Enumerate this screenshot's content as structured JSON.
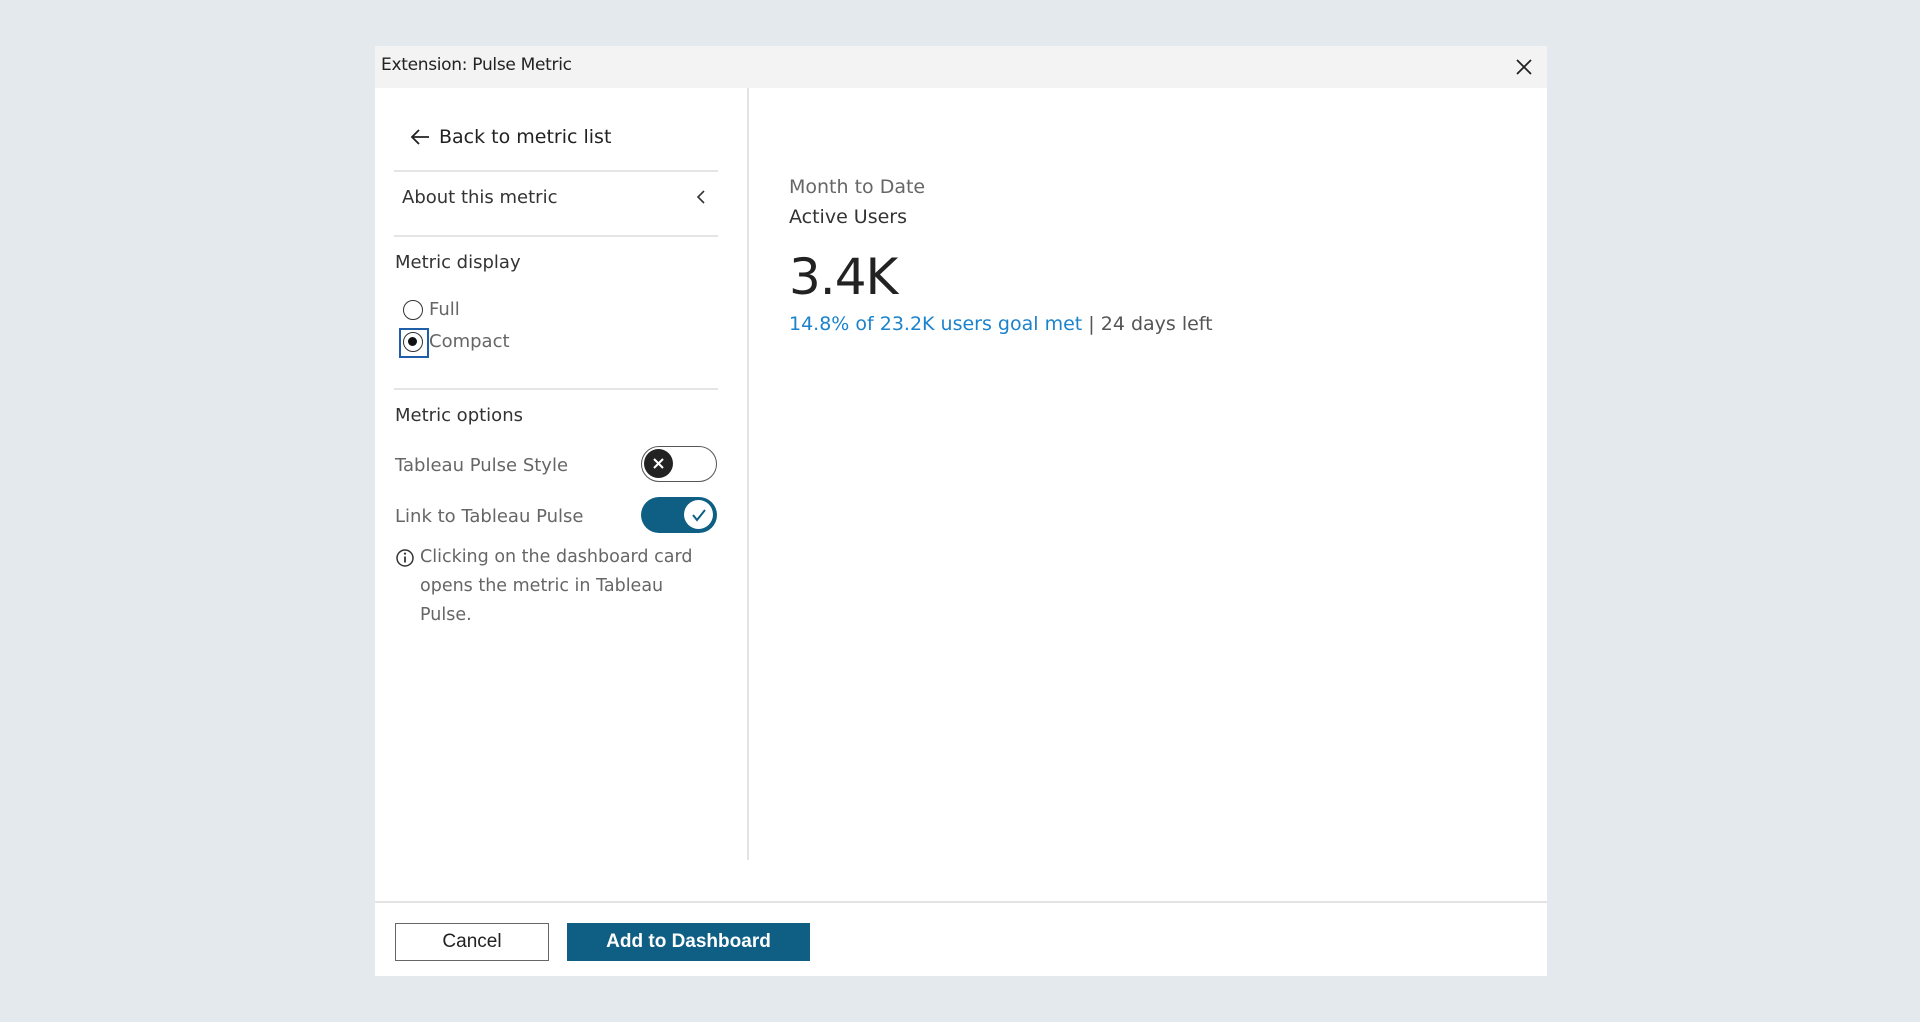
{
  "dialog": {
    "title": "Extension: Pulse Metric"
  },
  "sidebar": {
    "back_label": "Back to metric list",
    "about_label": "About this metric",
    "metric_display": {
      "heading": "Metric display",
      "options": [
        {
          "label": "Full",
          "selected": false
        },
        {
          "label": "Compact",
          "selected": true
        }
      ]
    },
    "metric_options": {
      "heading": "Metric options",
      "pulse_style": {
        "label": "Tableau Pulse Style",
        "enabled": false
      },
      "link_pulse": {
        "label": "Link to Tableau Pulse",
        "enabled": true
      },
      "info_text": "Clicking on the dashboard card opens the metric in Tableau Pulse."
    }
  },
  "main": {
    "period": "Month to Date",
    "metric_name": "Active Users",
    "value": "3.4K",
    "goal_text": "14.8% of 23.2K users goal met",
    "separator": "|",
    "days_left": "24 days left"
  },
  "footer": {
    "cancel_label": "Cancel",
    "add_label": "Add to Dashboard"
  },
  "colors": {
    "accent": "#0f5f85",
    "link": "#1b82cc",
    "focus": "#1f5fa8",
    "background": "#e4e9ee"
  }
}
